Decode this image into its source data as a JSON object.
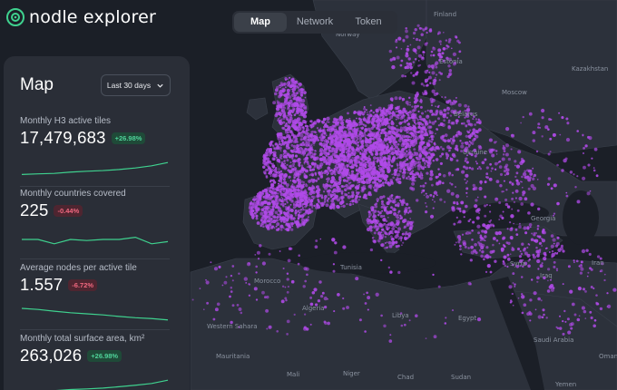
{
  "brand": {
    "name": "nodle explorer",
    "accent": "#3fd28f"
  },
  "tabs": [
    {
      "label": "Map",
      "active": true
    },
    {
      "label": "Network",
      "active": false
    },
    {
      "label": "Token",
      "active": false
    }
  ],
  "panel": {
    "title": "Map",
    "range_select": {
      "value": "Last 30 days",
      "icon": "chevron-down-icon"
    },
    "metrics": [
      {
        "label": "Monthly H3 active tiles",
        "value": "17,479,683",
        "change": "+26.98%",
        "trend": "up",
        "spark": [
          0.15,
          0.18,
          0.2,
          0.26,
          0.3,
          0.33,
          0.38,
          0.45,
          0.55,
          0.7
        ]
      },
      {
        "label": "Monthly countries covered",
        "value": "225",
        "change": "-0.44%",
        "trend": "down",
        "spark": [
          0.5,
          0.5,
          0.3,
          0.5,
          0.45,
          0.5,
          0.5,
          0.6,
          0.3,
          0.4
        ]
      },
      {
        "label": "Average nodes per active tile",
        "value": "1.557",
        "change": "-6.72%",
        "trend": "down",
        "spark": [
          0.75,
          0.7,
          0.62,
          0.55,
          0.5,
          0.45,
          0.38,
          0.32,
          0.28,
          0.22
        ]
      },
      {
        "label": "Monthly total surface area, km²",
        "value": "263,026",
        "change": "+26.98%",
        "trend": "up",
        "spark": [
          0.15,
          0.18,
          0.22,
          0.27,
          0.3,
          0.34,
          0.4,
          0.47,
          0.55,
          0.7
        ]
      }
    ]
  },
  "map": {
    "dot_color": "#b04ae8",
    "labels": [
      "Finland",
      "Norway",
      "Estonia",
      "Moscow",
      "Belarus",
      "Ukraine",
      "Tunisia",
      "Morocco",
      "Algeria",
      "Libya",
      "Egypt",
      "Syria",
      "Iraq",
      "Iran",
      "Saudi Arabia",
      "Western Sahara",
      "Mauritania",
      "Mali",
      "Niger",
      "Chad",
      "Sudan",
      "Yemen",
      "Oman",
      "Kazakhstan",
      "Georgia"
    ]
  }
}
